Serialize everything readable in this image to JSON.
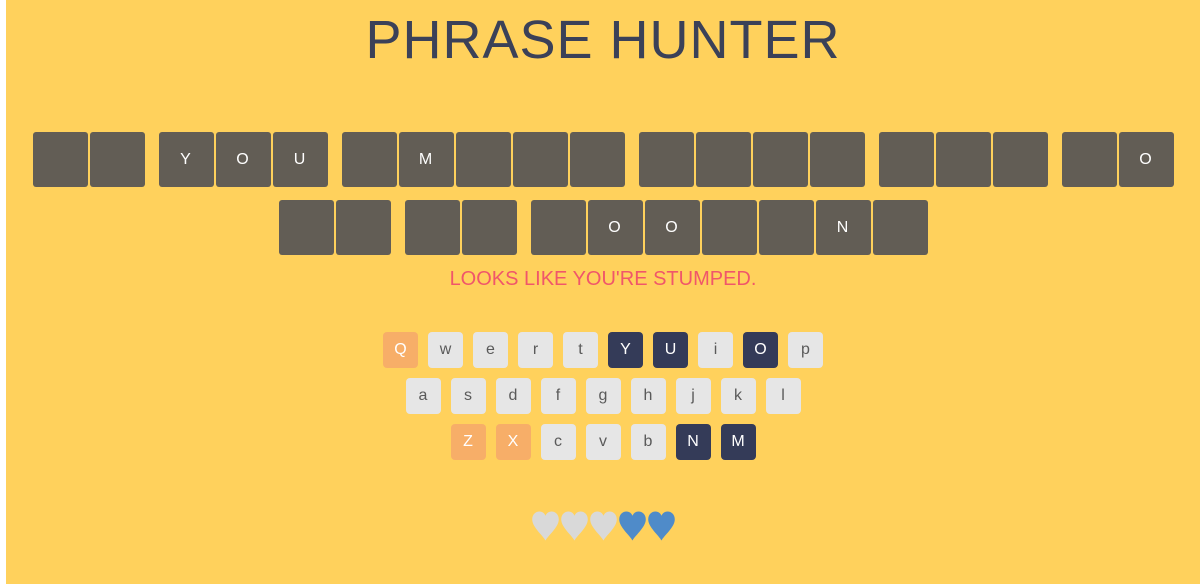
{
  "title": "PHRASE HUNTER",
  "phrase": {
    "rows": [
      [
        [
          "",
          ""
        ],
        [
          "Y",
          "O",
          "U"
        ],
        [
          "",
          "M",
          "",
          "",
          ""
        ],
        [
          "",
          "",
          "",
          ""
        ],
        [
          "",
          "",
          ""
        ],
        [
          "",
          "O"
        ]
      ],
      [
        [
          "",
          ""
        ],
        [
          "",
          ""
        ],
        [
          "",
          "O",
          "O",
          "",
          "",
          "N",
          ""
        ]
      ]
    ]
  },
  "message": "LOOKS LIKE YOU'RE STUMPED.",
  "keyboard": {
    "rows": [
      [
        {
          "label": "Q",
          "state": "wrong"
        },
        {
          "label": "w",
          "state": "unused"
        },
        {
          "label": "e",
          "state": "unused"
        },
        {
          "label": "r",
          "state": "unused"
        },
        {
          "label": "t",
          "state": "unused"
        },
        {
          "label": "Y",
          "state": "correct"
        },
        {
          "label": "U",
          "state": "correct"
        },
        {
          "label": "i",
          "state": "unused"
        },
        {
          "label": "O",
          "state": "correct"
        },
        {
          "label": "p",
          "state": "unused"
        }
      ],
      [
        {
          "label": "a",
          "state": "unused"
        },
        {
          "label": "s",
          "state": "unused"
        },
        {
          "label": "d",
          "state": "unused"
        },
        {
          "label": "f",
          "state": "unused"
        },
        {
          "label": "g",
          "state": "unused"
        },
        {
          "label": "h",
          "state": "unused"
        },
        {
          "label": "j",
          "state": "unused"
        },
        {
          "label": "k",
          "state": "unused"
        },
        {
          "label": "l",
          "state": "unused"
        }
      ],
      [
        {
          "label": "Z",
          "state": "wrong"
        },
        {
          "label": "X",
          "state": "wrong"
        },
        {
          "label": "c",
          "state": "unused"
        },
        {
          "label": "v",
          "state": "unused"
        },
        {
          "label": "b",
          "state": "unused"
        },
        {
          "label": "N",
          "state": "correct"
        },
        {
          "label": "M",
          "state": "correct"
        }
      ]
    ]
  },
  "lives": {
    "total": 5,
    "remaining": 2,
    "lost_color": "#d9d9d9",
    "live_color": "#4f8bc9"
  },
  "colors": {
    "background": "#ffd15c",
    "title": "#3b4158",
    "tile": "#625d55",
    "message": "#f0566a",
    "key_unused": "#e6e6e6",
    "key_wrong": "#f7ae68",
    "key_correct": "#343b58"
  }
}
